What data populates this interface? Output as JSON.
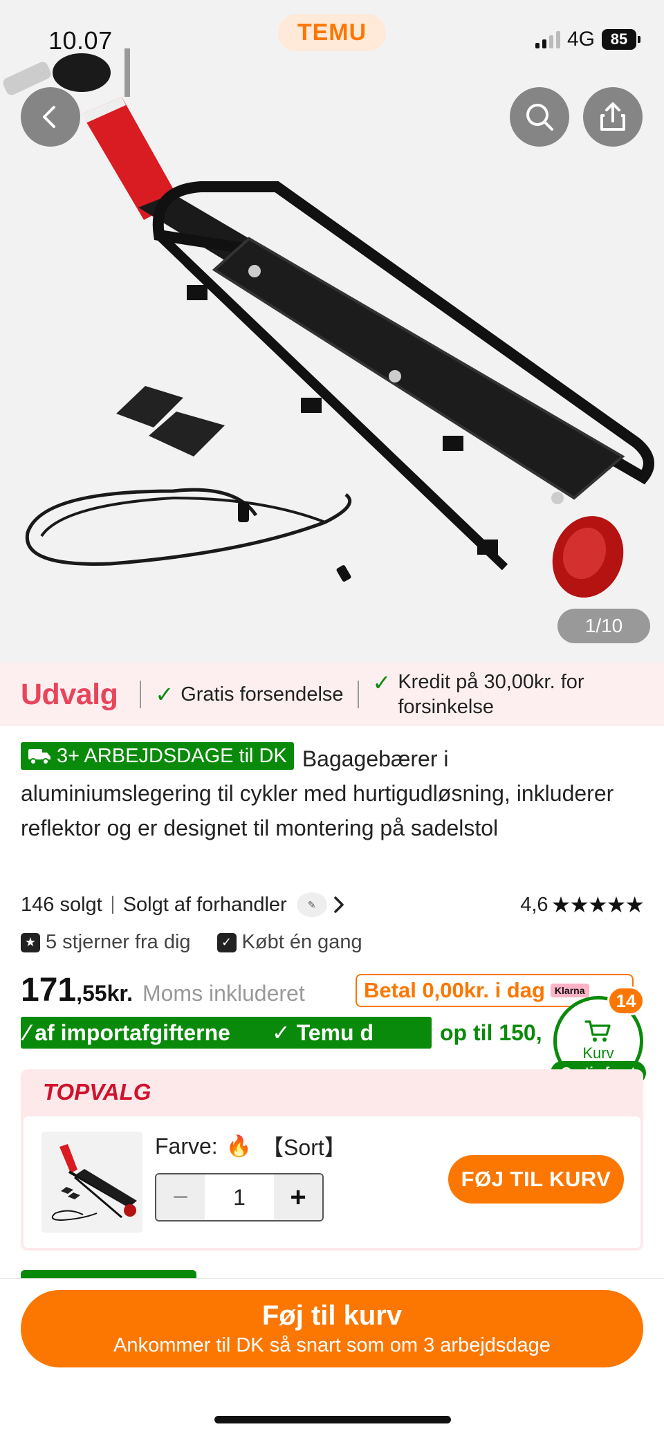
{
  "status_bar": {
    "time": "10.07",
    "network": "4G",
    "battery": "85"
  },
  "header": {
    "logo": "TEMU"
  },
  "gallery": {
    "counter": "1/10"
  },
  "selection_banner": {
    "label": "Udvalg",
    "benefit_1": "Gratis forsendelse",
    "benefit_2": "Kredit på 30,00kr. for forsinkelse"
  },
  "product": {
    "shipping_badge": "3+ ARBEJDSDAGE til DK",
    "title": "Bagagebærer i aluminiumslegering til cykler med hurtigudløsning, inkluderer reflektor og er designet til montering på sadelstol",
    "sold": "146 solgt",
    "seller": "Solgt af forhandler",
    "rating": "4,6",
    "stars": "★★★★★",
    "own_rating": "5 stjerner fra dig",
    "bought": "Købt én gang",
    "price_int": "171",
    "price_dec": ",55",
    "price_currency": "kr.",
    "vat_note": "Moms inkluderet",
    "klarna_text": "Betal 0,00kr. i dag",
    "klarna_badge": "Klarna",
    "promo_green_1": "⁄ af importafgifterne",
    "promo_green_2": "✓ Temu d",
    "promo_text": "op til 150,"
  },
  "cart_float": {
    "count": "14",
    "label": "Kurv",
    "free_shipping": "Gratis fragt"
  },
  "top_pick": {
    "title": "TOPVALG",
    "color_label": "Farve:",
    "color_value": "【Sort】",
    "quantity": "1",
    "add_button": "FØJ TIL KURV"
  },
  "bottom_bar": {
    "button_label": "Føj til kurv",
    "button_sub": "Ankommer til DK så snart som om 3 arbejdsdage"
  },
  "colors": {
    "brand_orange": "#fb7701",
    "green": "#0a8a0a",
    "udvalg_pink": "#e8455b",
    "topvalg_red": "#d0112b"
  }
}
